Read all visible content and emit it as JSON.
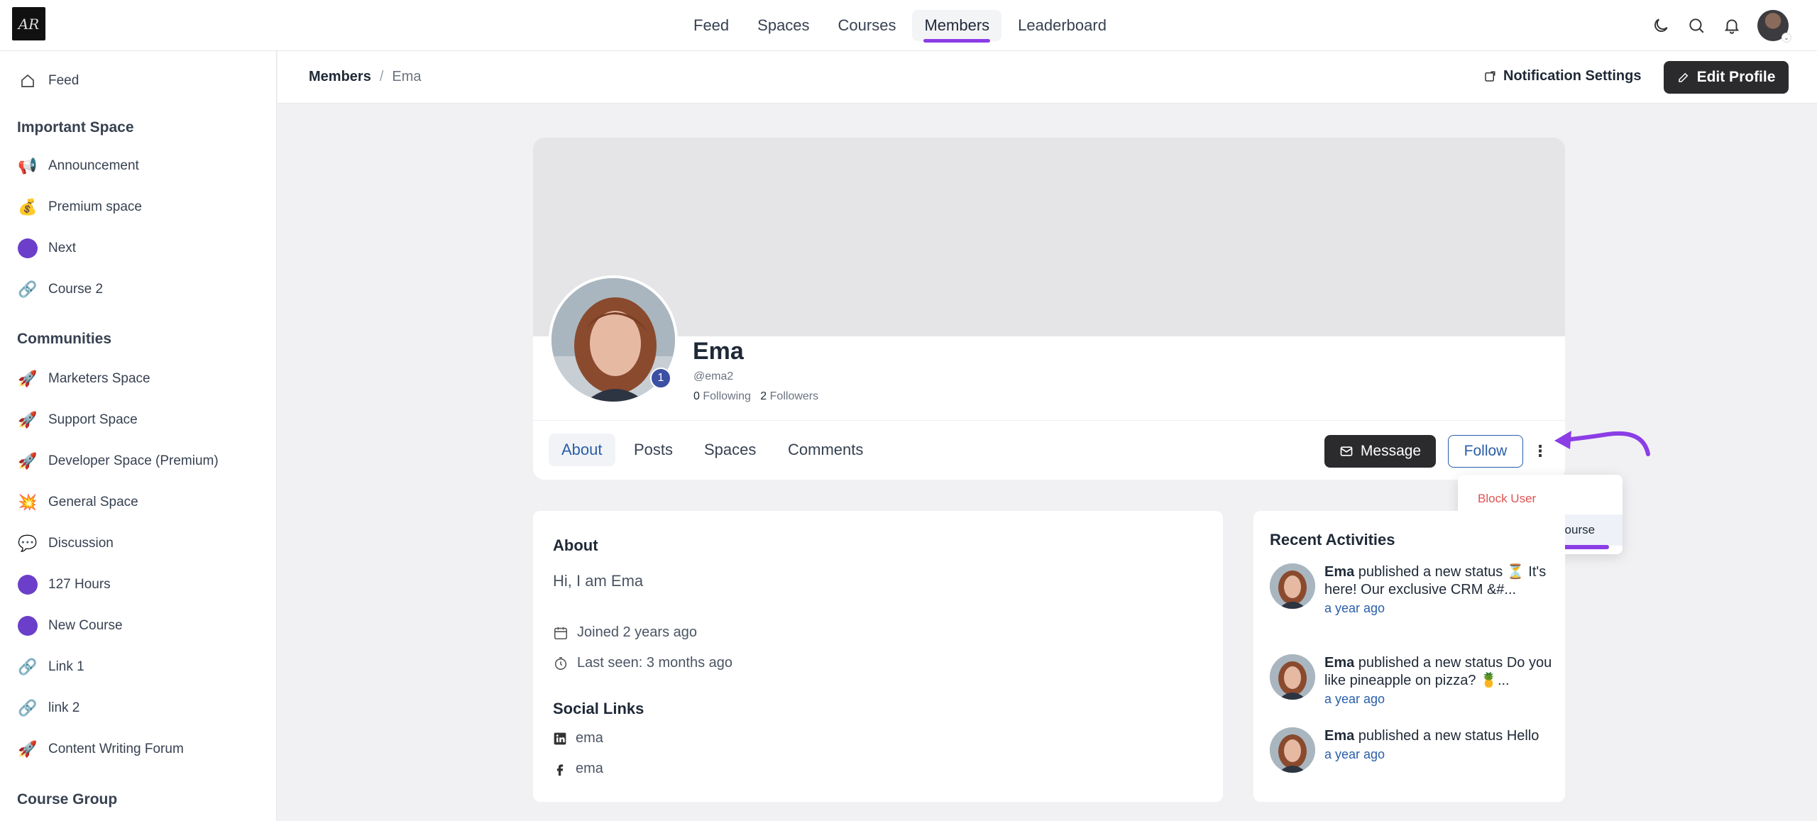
{
  "topnav": {
    "logo_text": "AR",
    "tabs": [
      {
        "label": "Feed"
      },
      {
        "label": "Spaces"
      },
      {
        "label": "Courses"
      },
      {
        "label": "Members"
      },
      {
        "label": "Leaderboard"
      }
    ],
    "active_tab": "Members",
    "icons": [
      "moon-icon",
      "search-icon",
      "bell-icon"
    ]
  },
  "sidebar": {
    "feed_label": "Feed",
    "important_heading": "Important Space",
    "important_items": [
      {
        "label": "Announcement",
        "icon": "📢"
      },
      {
        "label": "Premium space",
        "icon": "💰"
      },
      {
        "label": "Next",
        "icon": "dot"
      },
      {
        "label": "Course 2",
        "icon": "🔗"
      }
    ],
    "communities_heading": "Communities",
    "community_items": [
      {
        "label": "Marketers Space",
        "icon": "🚀"
      },
      {
        "label": "Support Space",
        "icon": "🚀"
      },
      {
        "label": "Developer Space (Premium)",
        "icon": "🚀"
      },
      {
        "label": "General Space",
        "icon": "💥"
      },
      {
        "label": "Discussion",
        "icon": "💬"
      },
      {
        "label": "127 Hours",
        "icon": "dot"
      },
      {
        "label": "New Course",
        "icon": "dot"
      },
      {
        "label": "Link 1",
        "icon": "🔗"
      },
      {
        "label": "link 2",
        "icon": "🔗"
      },
      {
        "label": "Content Writing Forum",
        "icon": "🚀"
      }
    ],
    "course_group_heading": "Course Group"
  },
  "subheader": {
    "breadcrumb_root": "Members",
    "breadcrumb_separator": "/",
    "breadcrumb_current": "Ema",
    "notification_settings": "Notification Settings",
    "edit_profile": "Edit Profile"
  },
  "profile": {
    "name": "Ema",
    "handle": "@ema2",
    "badge": "1",
    "following_count": "0",
    "following_label": "Following",
    "followers_count": "2",
    "followers_label": "Followers",
    "tabs": [
      "About",
      "Posts",
      "Spaces",
      "Comments"
    ],
    "active_tab": "About",
    "message_label": "Message",
    "follow_label": "Follow",
    "more_label": "⋮"
  },
  "dropdown": {
    "block_user": "Block User",
    "add_to_space": "Add To Space/Course"
  },
  "about": {
    "heading": "About",
    "bio": "Hi, I am Ema",
    "joined": "Joined 2 years ago",
    "last_seen": "Last seen: 3 months ago",
    "social_heading": "Social Links",
    "linkedin": "ema",
    "facebook": "ema"
  },
  "recent": {
    "heading": "Recent Activities",
    "items": [
      {
        "author": "Ema",
        "text": " published a new status ⏳ It's here! Our exclusive CRM &#...",
        "time": "a year ago"
      },
      {
        "author": "Ema",
        "text": " published a new status Do you like pineapple on pizza? 🍍...",
        "time": "a year ago"
      },
      {
        "author": "Ema",
        "text": " published a new status Hello",
        "time": "a year ago"
      }
    ]
  },
  "colors": {
    "accent_purple": "#8b3de6",
    "link_blue": "#2a5ea8",
    "danger_red": "#e05252",
    "dark_button": "#2b2b2e"
  }
}
